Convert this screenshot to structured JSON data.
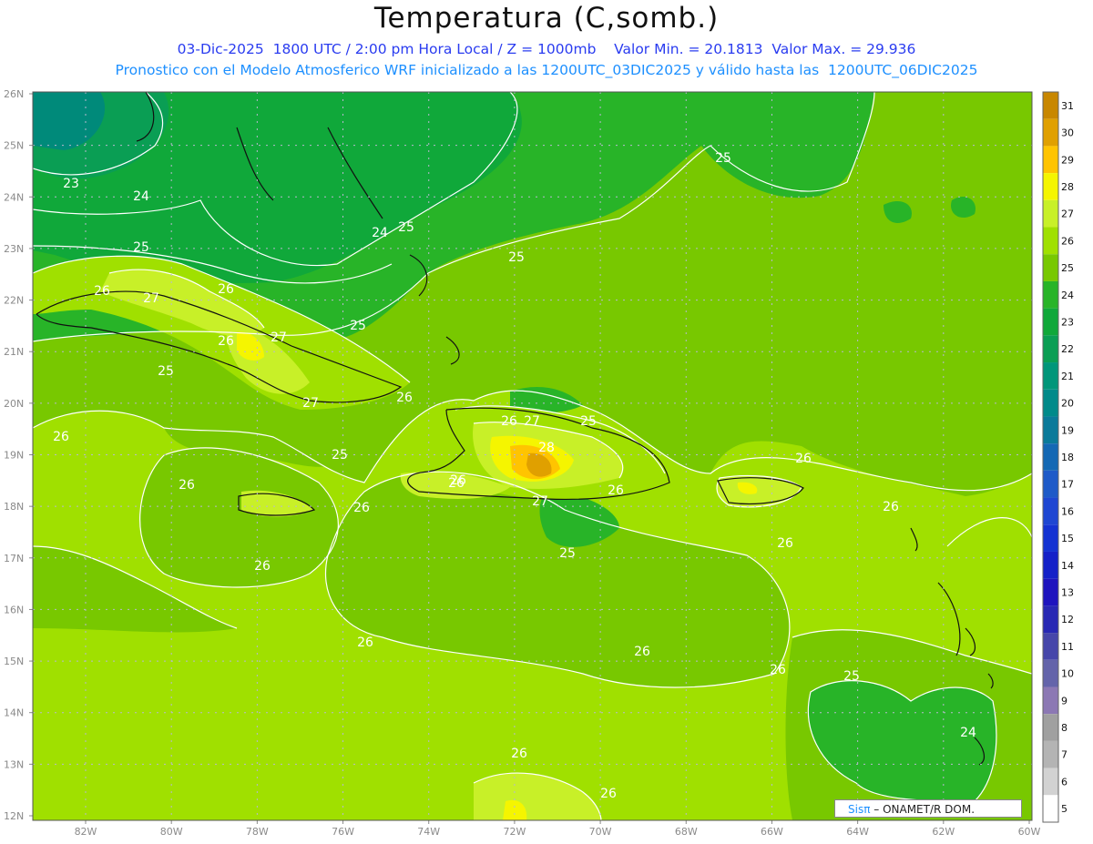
{
  "title": "Temperatura (C,somb.)",
  "subtitle_line1": "03-Dic-2025  1800 UTC / 2:00 pm Hora Local / Z = 1000mb    Valor Min. = 20.1813  Valor Max. = 29.936",
  "subtitle_line2": "Pronostico con el Modelo Atmosferico WRF inicializado a las 1200UTC_03DIC2025 y válido hasta las  1200UTC_06DIC2025",
  "y_labels": [
    "26N",
    "25N",
    "24N",
    "23N",
    "22N",
    "21N",
    "20N",
    "19N",
    "18N",
    "17N",
    "16N",
    "15N",
    "14N",
    "13N",
    "12N"
  ],
  "x_labels": [
    "82W",
    "80W",
    "78W",
    "76W",
    "74W",
    "72W",
    "70W",
    "68W",
    "66W",
    "64W",
    "62W",
    "60W"
  ],
  "colorbar": {
    "labels": [
      "31",
      "30",
      "29",
      "28",
      "27",
      "26",
      "25",
      "24",
      "23",
      "22",
      "21",
      "20",
      "19",
      "18",
      "17",
      "16",
      "15",
      "14",
      "13",
      "12",
      "11",
      "10",
      "9",
      "8",
      "7",
      "6",
      "5"
    ],
    "colors": [
      "#c88700",
      "#e0a000",
      "#ffc400",
      "#f5f500",
      "#c8f028",
      "#a0e000",
      "#78c800",
      "#28b428",
      "#10a83a",
      "#0a9e54",
      "#00967a",
      "#008a8a",
      "#0a7a9a",
      "#1468b4",
      "#1e5ac8",
      "#1e46d2",
      "#1432d2",
      "#1420c8",
      "#1e14be",
      "#2828b4",
      "#4646aa",
      "#6464aa",
      "#8c78b4",
      "#a0a0a0",
      "#b4b4b4",
      "#d2d2d2",
      "#ffffff"
    ]
  },
  "contour_labels": [
    {
      "text": "23"
    },
    {
      "text": "24"
    },
    {
      "text": "25"
    },
    {
      "text": "26"
    },
    {
      "text": "27"
    },
    {
      "text": "26"
    },
    {
      "text": "25"
    },
    {
      "text": "26"
    },
    {
      "text": "25"
    },
    {
      "text": "27"
    },
    {
      "text": "25"
    },
    {
      "text": "27"
    },
    {
      "text": "26"
    },
    {
      "text": "25"
    },
    {
      "text": "24"
    },
    {
      "text": "25"
    },
    {
      "text": "25"
    },
    {
      "text": "26"
    },
    {
      "text": "28"
    },
    {
      "text": "27"
    },
    {
      "text": "26"
    },
    {
      "text": "25"
    },
    {
      "text": "26"
    },
    {
      "text": "27"
    },
    {
      "text": "26"
    },
    {
      "text": "25"
    },
    {
      "text": "26"
    },
    {
      "text": "26"
    },
    {
      "text": "26"
    },
    {
      "text": "26"
    },
    {
      "text": "26"
    },
    {
      "text": "26"
    },
    {
      "text": "26"
    },
    {
      "text": "26"
    },
    {
      "text": "25"
    },
    {
      "text": "24"
    },
    {
      "text": "26"
    },
    {
      "text": "26"
    },
    {
      "text": "26"
    },
    {
      "text": "26"
    }
  ],
  "watermark": {
    "sis": "Sisπ",
    "rest": " – ONAMET/R    DOM."
  }
}
